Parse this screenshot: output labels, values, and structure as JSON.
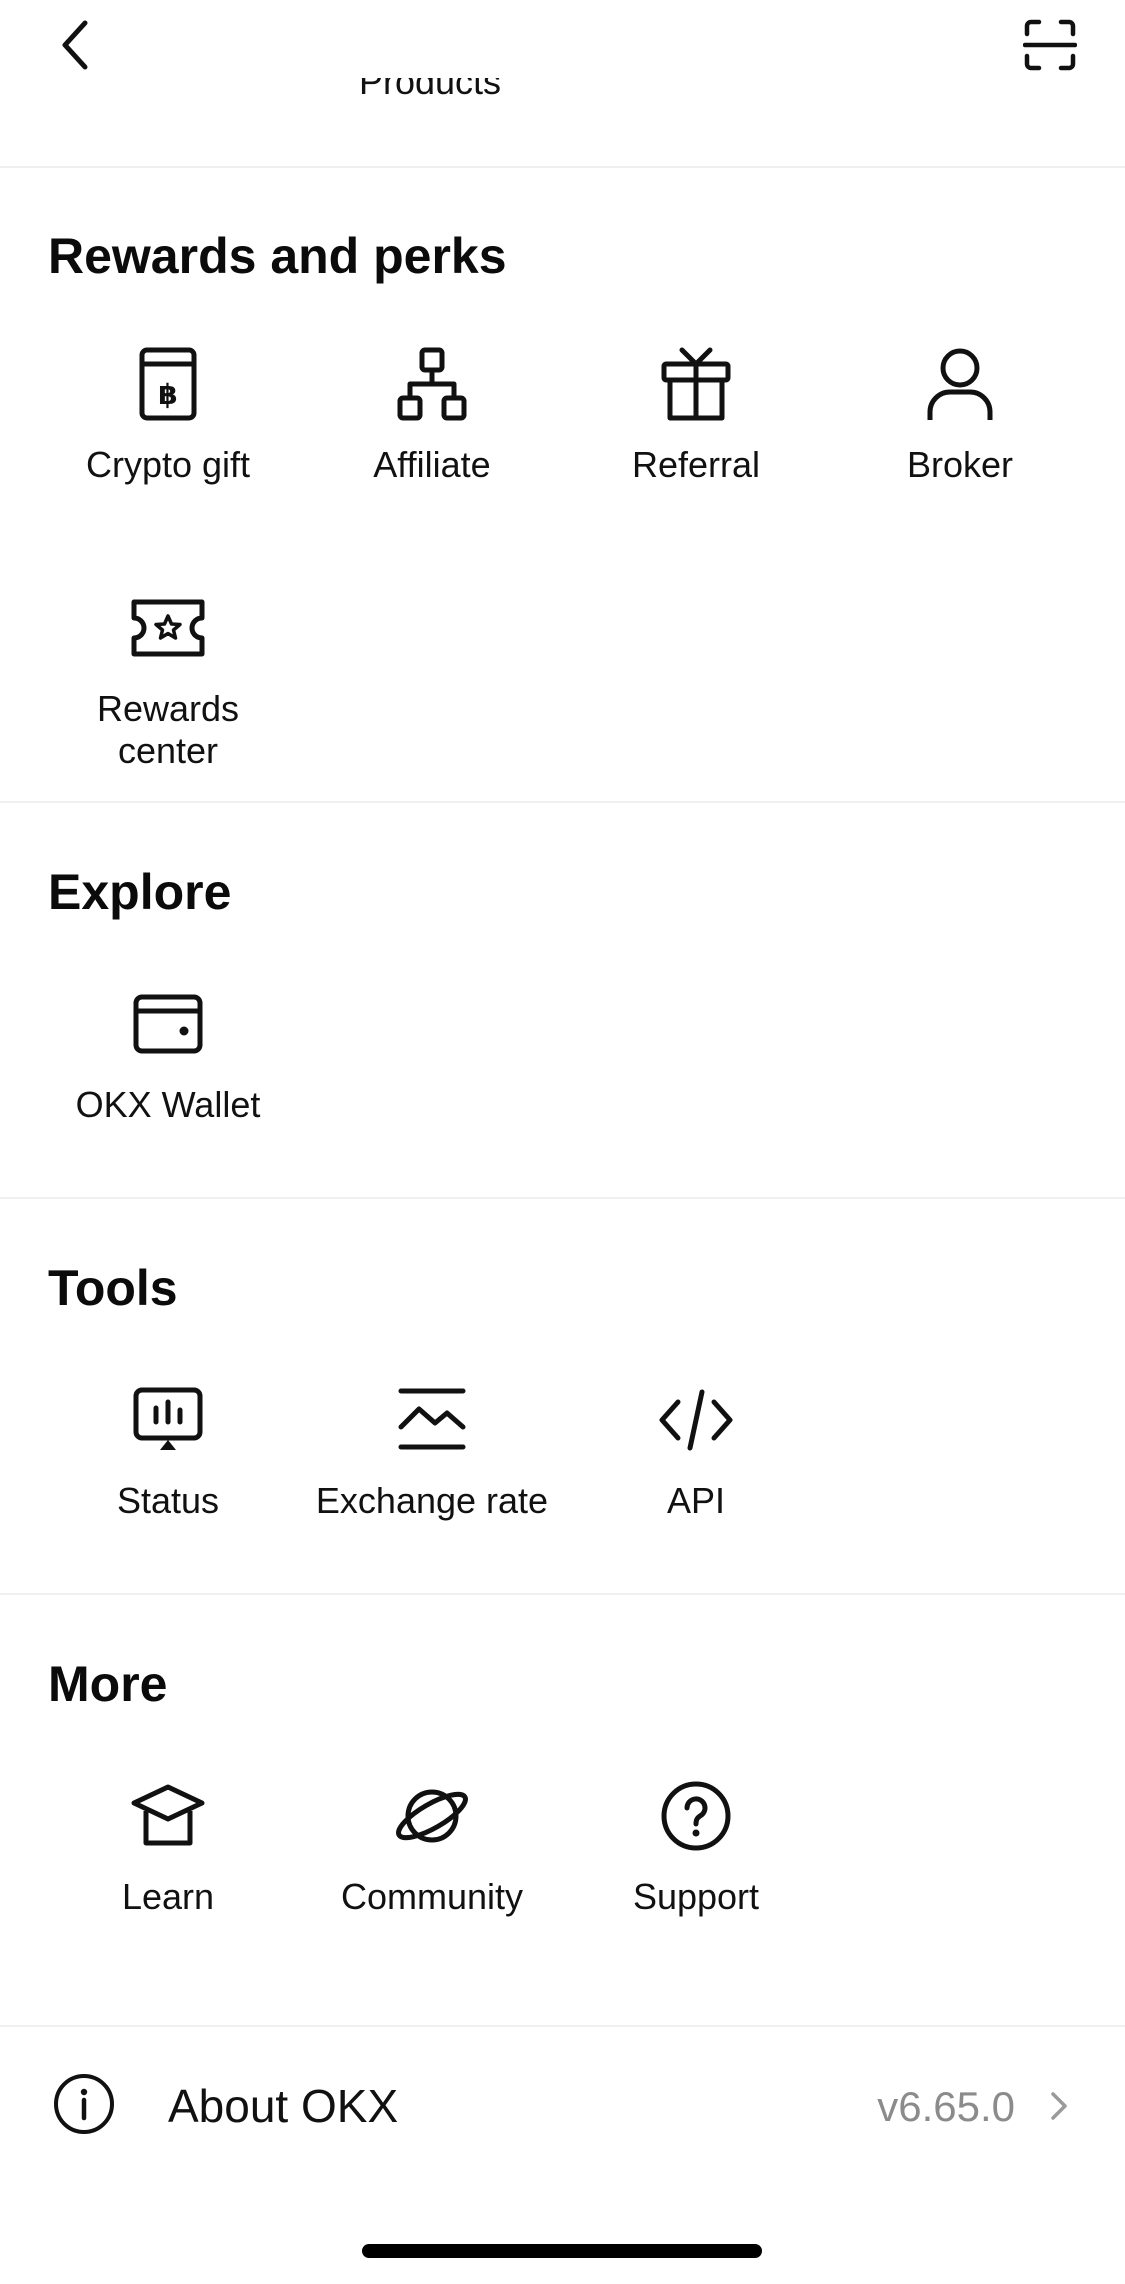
{
  "header": {
    "back_icon": "chevron-left-icon",
    "scan_icon": "scan-icon",
    "cut_off_label": "Products"
  },
  "sections": {
    "rewards": {
      "title": "Rewards and perks",
      "items": [
        {
          "label": "Crypto gift",
          "icon": "crypto-gift-icon"
        },
        {
          "label": "Affiliate",
          "icon": "affiliate-icon"
        },
        {
          "label": "Referral",
          "icon": "gift-icon"
        },
        {
          "label": "Broker",
          "icon": "user-icon"
        },
        {
          "label": "Rewards center",
          "icon": "ticket-icon"
        }
      ]
    },
    "explore": {
      "title": "Explore",
      "items": [
        {
          "label": "OKX Wallet",
          "icon": "wallet-icon"
        }
      ]
    },
    "tools": {
      "title": "Tools",
      "items": [
        {
          "label": "Status",
          "icon": "status-icon"
        },
        {
          "label": "Exchange rate",
          "icon": "exchange-rate-icon"
        },
        {
          "label": "API",
          "icon": "code-icon"
        }
      ]
    },
    "more": {
      "title": "More",
      "items": [
        {
          "label": "Learn",
          "icon": "graduation-cap-icon"
        },
        {
          "label": "Community",
          "icon": "planet-icon"
        },
        {
          "label": "Support",
          "icon": "help-icon"
        }
      ]
    }
  },
  "about": {
    "label": "About OKX",
    "version": "v6.65.0",
    "icon": "info-icon"
  }
}
